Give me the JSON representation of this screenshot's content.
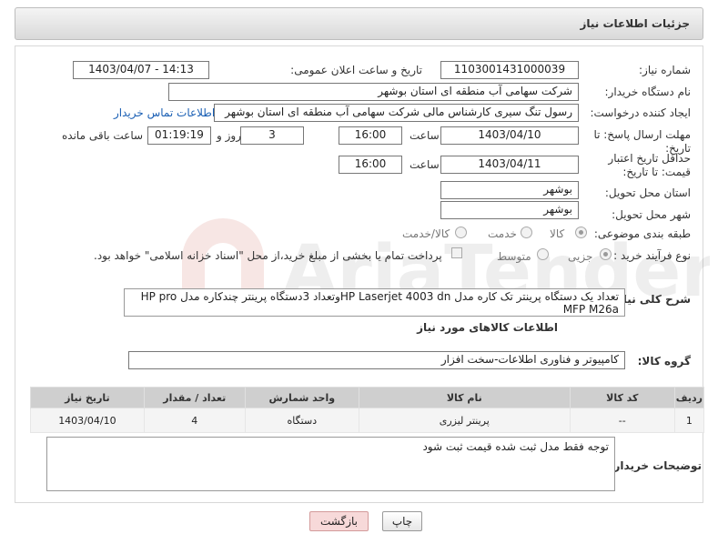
{
  "header": {
    "title": "جزئیات اطلاعات نیاز"
  },
  "form": {
    "need_number_label": "شماره نیاز:",
    "need_number": "1103001431000039",
    "announce_label": "تاریخ و ساعت اعلان عمومی:",
    "announce_value": "1403/04/07 - 14:13",
    "buyer_org_label": "نام دستگاه خریدار:",
    "buyer_org": "شرکت سهامی آب منطقه ای استان بوشهر",
    "creator_label": "ایجاد کننده درخواست:",
    "creator": "رسول تنگ سیری کارشناس مالی شرکت سهامی آب منطقه ای استان بوشهر",
    "contact_link": "اطلاعات تماس خریدار",
    "reply_deadline_label": "مهلت ارسال پاسخ: تا تاریخ:",
    "reply_date": "1403/04/10",
    "time_label": "ساعت",
    "reply_time": "16:00",
    "days_value": "3",
    "days_label": "روز و",
    "remaining_time": "01:19:19",
    "remaining_label": "ساعت باقی مانده",
    "price_validity_label": "حداقل تاریخ اعتبار قیمت: تا تاریخ:",
    "validity_date": "1403/04/11",
    "validity_time_label": "ساعت",
    "validity_time": "16:00",
    "province_label": "استان محل تحویل:",
    "province": "بوشهر",
    "city_label": "شهر محل تحویل:",
    "city": "بوشهر",
    "category_label": "طبقه بندی موضوعی:",
    "category_options": [
      "کالا",
      "خدمت",
      "کالا/خدمت"
    ],
    "purchase_type_label": "نوع فرآیند خرید :",
    "purchase_options": [
      "جزیی",
      "متوسط"
    ],
    "payment_note": "پرداخت تمام یا بخشی از مبلغ خرید،از محل \"اسناد خزانه اسلامی\" خواهد بود.",
    "desc_label": "شرح کلی نیاز:",
    "description": "تعداد یک دستگاه پرینتر تک کاره مدل HP Laserjet 4003 dnوتعداد 3دستگاه پرینتر چندکاره مدل HP pro MFP M26a",
    "goods_info_title": "اطلاعات کالاهای مورد نیاز",
    "goods_group_label": "گروه کالا:",
    "goods_group": "کامپیوتر و فناوری اطلاعات-سخت افزار",
    "buyer_notes_label": "توضیحات خریدار:",
    "buyer_notes": "توجه فقط مدل ثبت شده قیمت ثبت شود"
  },
  "table": {
    "headers": [
      "ردیف",
      "کد کالا",
      "نام کالا",
      "واحد شمارش",
      "تعداد / مقدار",
      "تاریخ نیاز"
    ],
    "rows": [
      [
        "1",
        "--",
        "پرینتر لیزری",
        "دستگاه",
        "4",
        "1403/04/10"
      ]
    ]
  },
  "buttons": {
    "print": "چاپ",
    "back": "بازگشت"
  },
  "watermark": {
    "text": "AriaTender.neT"
  }
}
